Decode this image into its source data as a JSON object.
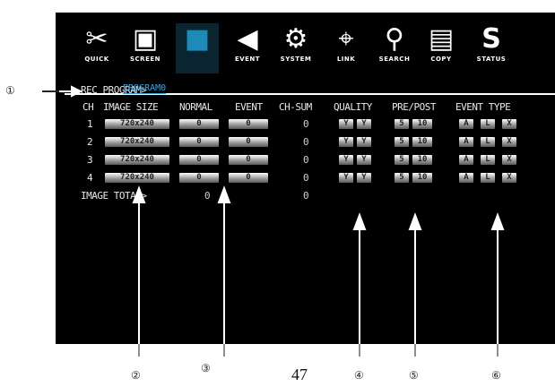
{
  "toolbar": {
    "items": [
      {
        "label": "QUICK",
        "icon": "tools-icon",
        "glyph": "✂"
      },
      {
        "label": "SCREEN",
        "icon": "monitor-icon",
        "glyph": "▣"
      },
      {
        "label": "",
        "icon": "camera-icon",
        "glyph": "■"
      },
      {
        "label": "EVENT",
        "icon": "speaker-icon",
        "glyph": "◀"
      },
      {
        "label": "SYSTEM",
        "icon": "gears-icon",
        "glyph": "⚙"
      },
      {
        "label": "LINK",
        "icon": "satellite-icon",
        "glyph": "⌖"
      },
      {
        "label": "SEARCH",
        "icon": "magnifier-icon",
        "glyph": "⚲"
      },
      {
        "label": "COPY",
        "icon": "document-icon",
        "glyph": "▤"
      },
      {
        "label": "STATUS",
        "icon": "status-icon",
        "glyph": "S"
      }
    ]
  },
  "breadcrumb": {
    "path": "REC PROGRAM>",
    "current": "PROGRAM0"
  },
  "headers": {
    "ch": "CH",
    "image_size": "IMAGE SIZE",
    "normal": "NORMAL",
    "event": "EVENT",
    "ch_sum": "CH-SUM",
    "quality": "QUALITY",
    "pre_post": "PRE/POST",
    "event_type": "EVENT TYPE"
  },
  "rows": [
    {
      "ch": "1",
      "size": "720x240",
      "normal": "0",
      "event": "0",
      "sum": "0",
      "q1": "Y",
      "q2": "Y",
      "pre": "5",
      "post": "10",
      "t1": "A",
      "t2": "L",
      "t3": "X"
    },
    {
      "ch": "2",
      "size": "720x240",
      "normal": "0",
      "event": "0",
      "sum": "0",
      "q1": "Y",
      "q2": "Y",
      "pre": "5",
      "post": "10",
      "t1": "A",
      "t2": "L",
      "t3": "X"
    },
    {
      "ch": "3",
      "size": "720x240",
      "normal": "0",
      "event": "0",
      "sum": "0",
      "q1": "Y",
      "q2": "Y",
      "pre": "5",
      "post": "10",
      "t1": "A",
      "t2": "L",
      "t3": "X"
    },
    {
      "ch": "4",
      "size": "720x240",
      "normal": "0",
      "event": "0",
      "sum": "0",
      "q1": "Y",
      "q2": "Y",
      "pre": "5",
      "post": "10",
      "t1": "A",
      "t2": "L",
      "t3": "X"
    }
  ],
  "total": {
    "label": "IMAGE TOTAL>",
    "normal": "0",
    "sum": "0"
  },
  "callouts": [
    "①",
    "②",
    "③",
    "④",
    "⑤",
    "⑥"
  ],
  "page_number": "47"
}
